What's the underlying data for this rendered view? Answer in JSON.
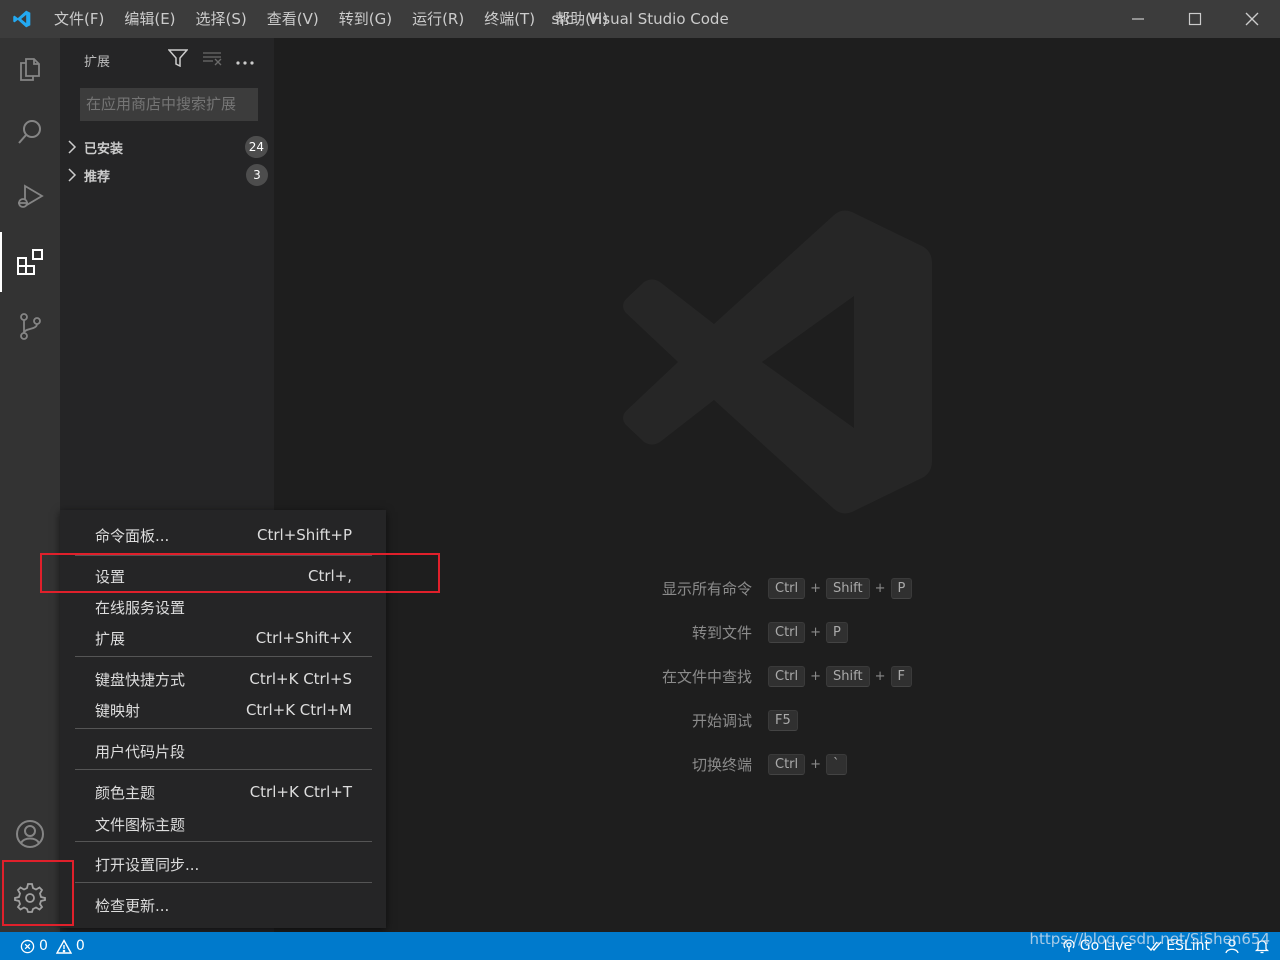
{
  "window": {
    "title": "src - Visual Studio Code"
  },
  "menubar": {
    "items": [
      "文件(F)",
      "编辑(E)",
      "选择(S)",
      "查看(V)",
      "转到(G)",
      "运行(R)",
      "终端(T)",
      "帮助(H)"
    ]
  },
  "sidebar": {
    "title": "扩展",
    "search_placeholder": "在应用商店中搜索扩展",
    "sections": [
      {
        "label": "已安装",
        "count": "24"
      },
      {
        "label": "推荐",
        "count": "3"
      }
    ]
  },
  "editor": {
    "shortcuts": [
      {
        "label": "显示所有命令",
        "keys": [
          "Ctrl",
          "Shift",
          "P"
        ]
      },
      {
        "label": "转到文件",
        "keys": [
          "Ctrl",
          "P"
        ]
      },
      {
        "label": "在文件中查找",
        "keys": [
          "Ctrl",
          "Shift",
          "F"
        ]
      },
      {
        "label": "开始调试",
        "keys": [
          "F5"
        ]
      },
      {
        "label": "切换终端",
        "keys": [
          "Ctrl",
          "`"
        ]
      }
    ]
  },
  "context_menu": {
    "items": [
      {
        "label": "命令面板...",
        "shortcut": "Ctrl+Shift+P"
      },
      {
        "label": "设置",
        "shortcut": "Ctrl+,"
      },
      {
        "label": "在线服务设置",
        "shortcut": ""
      },
      {
        "label": "扩展",
        "shortcut": "Ctrl+Shift+X"
      },
      {
        "label": "键盘快捷方式",
        "shortcut": "Ctrl+K Ctrl+S"
      },
      {
        "label": "键映射",
        "shortcut": "Ctrl+K Ctrl+M"
      },
      {
        "label": "用户代码片段",
        "shortcut": ""
      },
      {
        "label": "颜色主题",
        "shortcut": "Ctrl+K Ctrl+T"
      },
      {
        "label": "文件图标主题",
        "shortcut": ""
      },
      {
        "label": "打开设置同步...",
        "shortcut": ""
      },
      {
        "label": "检查更新...",
        "shortcut": ""
      }
    ]
  },
  "statusbar": {
    "errors": "0",
    "warnings": "0",
    "go_live": "Go Live",
    "eslint": "ESLint",
    "watermark_url": "https://blog.csdn.net/SiShen654"
  },
  "colors": {
    "accent": "#007acc",
    "highlight": "#e0202b"
  }
}
